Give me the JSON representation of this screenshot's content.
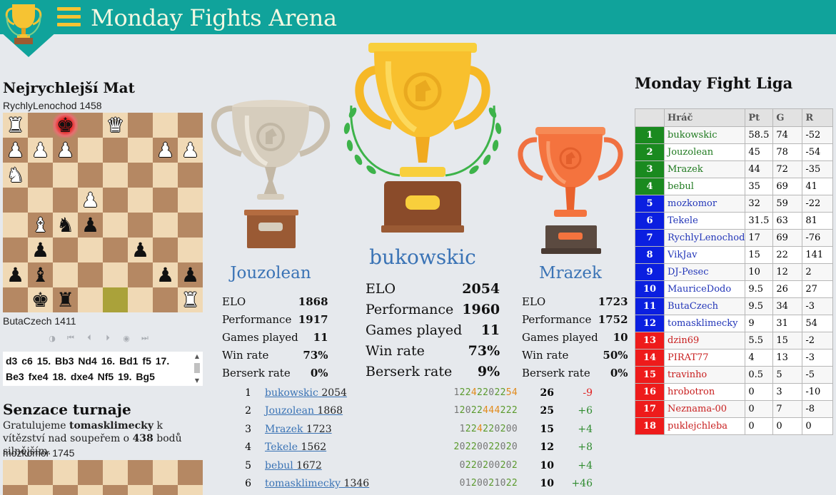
{
  "header": {
    "title": "Monday Fights Arena",
    "menu_icon": "hamburger-icon",
    "logo_icon": "trophy-icon"
  },
  "colors": {
    "header_bg": "#10a39b",
    "title": "#f3f8e2",
    "link": "#3a73b5",
    "gold": "#f6c333",
    "green": "#1a8a1f",
    "blue": "#0b1fe0",
    "red": "#ee1b1b"
  },
  "fastest_mate": {
    "title": "Nejrychlejší Mat",
    "top_player": "RychlyLenochod 1458",
    "bottom_player": "ButaCzech 1411",
    "board": [
      [
        "wR",
        "",
        "bK!",
        "",
        "wQ",
        "",
        "",
        ""
      ],
      [
        "wP",
        "wP",
        "wP",
        "",
        "",
        "",
        "wP",
        "wP"
      ],
      [
        "wN",
        "",
        "",
        "",
        "",
        "",
        "",
        ""
      ],
      [
        "",
        "",
        "",
        "wP",
        "",
        "",
        "",
        ""
      ],
      [
        "",
        "wB",
        "bN",
        "bP",
        "",
        "",
        "",
        ""
      ],
      [
        "",
        "bP",
        "",
        "",
        "",
        "bP",
        "",
        ""
      ],
      [
        "bP",
        "bB",
        "",
        "",
        "",
        "",
        "bP",
        "bP"
      ],
      [
        "",
        "bK",
        "bR",
        "",
        "*",
        "",
        "",
        "wR"
      ]
    ],
    "controls": [
      "flip-icon",
      "first-move-icon",
      "prev-move-icon",
      "next-move-icon",
      "autoplay-icon",
      "last-move-icon"
    ],
    "moves": "d3 c6 15. Bb3 Nd4 16. Bd1 f5 17. Be3 fxe4 18. dxe4 Nf5 19. Bg5"
  },
  "sensation": {
    "title": "Senzace turnaje",
    "text_before": "Gratulujeme ",
    "winner": "tomasklimecky",
    "text_middle": " k vítězství nad soupeřem o ",
    "points": "438",
    "text_after": " bodů silnějším.",
    "top_player": "mozkomor 1745"
  },
  "podium": {
    "labels": {
      "elo": "ELO",
      "performance": "Performance",
      "games": "Games played",
      "winrate": "Win rate",
      "berserk": "Berserk rate"
    },
    "first": {
      "name": "bukowskic",
      "elo": "2054",
      "performance": "1960",
      "games": "11",
      "winrate": "73%",
      "berserk": "9%"
    },
    "second": {
      "name": "Jouzolean",
      "elo": "1868",
      "performance": "1917",
      "games": "11",
      "winrate": "73%",
      "berserk": "0%"
    },
    "third": {
      "name": "Mrazek",
      "elo": "1723",
      "performance": "1752",
      "games": "10",
      "winrate": "50%",
      "berserk": "0%"
    }
  },
  "standings": [
    {
      "rank": "1",
      "name": "bukowskic",
      "rating": "2054",
      "scores": "12242202254",
      "points": "26",
      "diff": "-9"
    },
    {
      "rank": "2",
      "name": "Jouzolean",
      "rating": "1868",
      "scores": "12022444222",
      "points": "25",
      "diff": "+6"
    },
    {
      "rank": "3",
      "name": "Mrazek",
      "rating": "1723",
      "scores": "1224220200",
      "points": "15",
      "diff": "+4"
    },
    {
      "rank": "4",
      "name": "Tekele",
      "rating": "1562",
      "scores": "20220022020",
      "points": "12",
      "diff": "+8"
    },
    {
      "rank": "5",
      "name": "bebul",
      "rating": "1672",
      "scores": "0220200202",
      "points": "10",
      "diff": "+4"
    },
    {
      "rank": "6",
      "name": "tomasklimecky",
      "rating": "1346",
      "scores": "0120021022",
      "points": "10",
      "diff": "+46"
    }
  ],
  "league": {
    "title": "Monday Fight Liga",
    "columns": [
      "",
      "Hráč",
      "Pt",
      "G",
      "R"
    ],
    "rows": [
      {
        "rank": "1",
        "name": "bukowskic",
        "pt": "58.5",
        "g": "74",
        "r": "-52",
        "zone": "green"
      },
      {
        "rank": "2",
        "name": "Jouzolean",
        "pt": "45",
        "g": "78",
        "r": "-54",
        "zone": "green"
      },
      {
        "rank": "3",
        "name": "Mrazek",
        "pt": "44",
        "g": "72",
        "r": "-35",
        "zone": "green"
      },
      {
        "rank": "4",
        "name": "bebul",
        "pt": "35",
        "g": "69",
        "r": "41",
        "zone": "green"
      },
      {
        "rank": "5",
        "name": "mozkomor",
        "pt": "32",
        "g": "59",
        "r": "-22",
        "zone": "blue"
      },
      {
        "rank": "6",
        "name": "Tekele",
        "pt": "31.5",
        "g": "63",
        "r": "81",
        "zone": "blue"
      },
      {
        "rank": "7",
        "name": "RychlyLenochod",
        "pt": "17",
        "g": "69",
        "r": "-76",
        "zone": "blue"
      },
      {
        "rank": "8",
        "name": "VikJav",
        "pt": "15",
        "g": "22",
        "r": "141",
        "zone": "blue"
      },
      {
        "rank": "9",
        "name": "DJ-Pesec",
        "pt": "10",
        "g": "12",
        "r": "2",
        "zone": "blue"
      },
      {
        "rank": "10",
        "name": "MauriceDodo",
        "pt": "9.5",
        "g": "26",
        "r": "27",
        "zone": "blue"
      },
      {
        "rank": "11",
        "name": "ButaCzech",
        "pt": "9.5",
        "g": "34",
        "r": "-3",
        "zone": "blue"
      },
      {
        "rank": "12",
        "name": "tomasklimecky",
        "pt": "9",
        "g": "31",
        "r": "54",
        "zone": "blue"
      },
      {
        "rank": "13",
        "name": "dzin69",
        "pt": "5.5",
        "g": "15",
        "r": "-2",
        "zone": "red"
      },
      {
        "rank": "14",
        "name": "PIRAT77",
        "pt": "4",
        "g": "13",
        "r": "-3",
        "zone": "red"
      },
      {
        "rank": "15",
        "name": "travinho",
        "pt": "0.5",
        "g": "5",
        "r": "-5",
        "zone": "red"
      },
      {
        "rank": "16",
        "name": "hrobotron",
        "pt": "0",
        "g": "3",
        "r": "-10",
        "zone": "red"
      },
      {
        "rank": "17",
        "name": "Neznama-00",
        "pt": "0",
        "g": "7",
        "r": "-8",
        "zone": "red"
      },
      {
        "rank": "18",
        "name": "puklejchleba",
        "pt": "0",
        "g": "0",
        "r": "0",
        "zone": "red"
      }
    ]
  }
}
